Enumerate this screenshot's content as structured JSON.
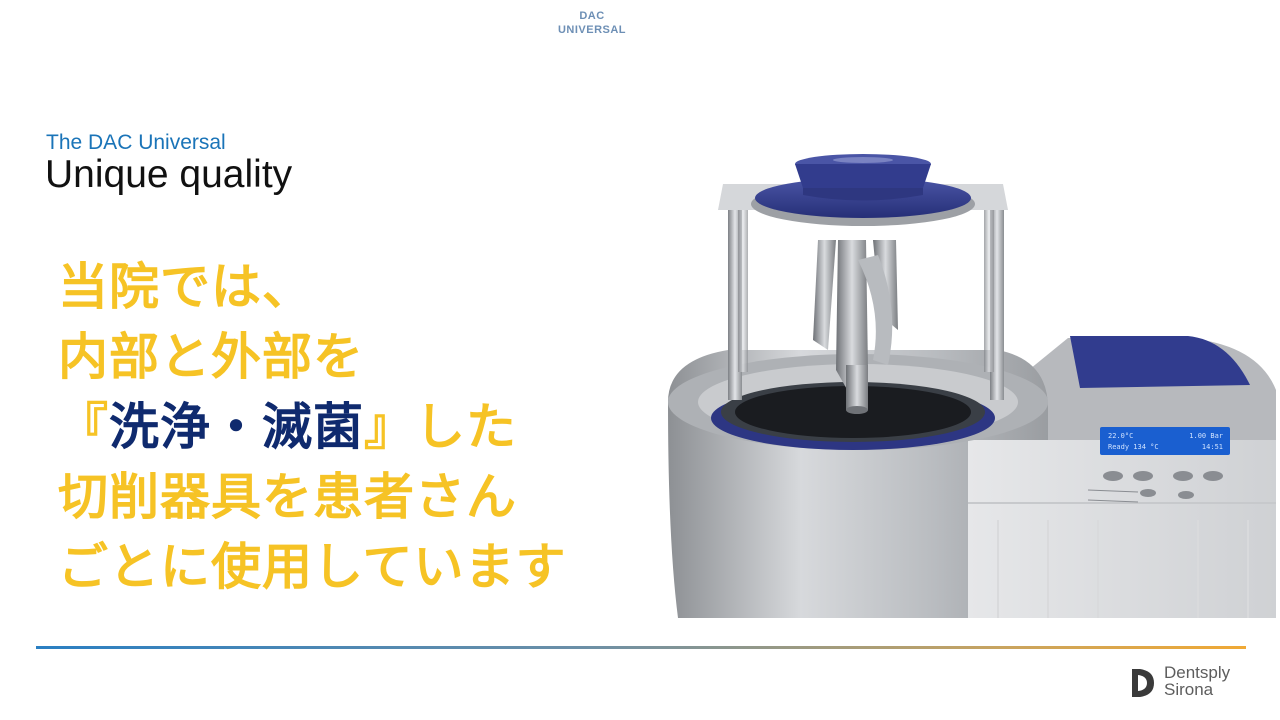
{
  "header": {
    "line1": "DAC",
    "line2": "UNIVERSAL"
  },
  "slide": {
    "subtitle": "The DAC Universal",
    "title": "Unique quality",
    "body": {
      "line1": "当院では、",
      "line2": "内部と外部を",
      "line3_open": "『",
      "line3_emph": "洗浄・滅菌",
      "line3_close": "』した",
      "line4": "切削器具を患者さん",
      "line5": "ごとに使用しています"
    }
  },
  "device_display": {
    "row1_left": "22.0°C",
    "row1_right": "1.00 Bar",
    "row2_left": "Ready 134 °C",
    "row2_right": "14:51"
  },
  "logo": {
    "line1": "Dentsply",
    "line2": "Sirona"
  },
  "colors": {
    "subtitle": "#1a74b8",
    "body_text": "#f6c325",
    "emphasis": "#0f2a6e",
    "device_lid": "#2e3a8c"
  }
}
